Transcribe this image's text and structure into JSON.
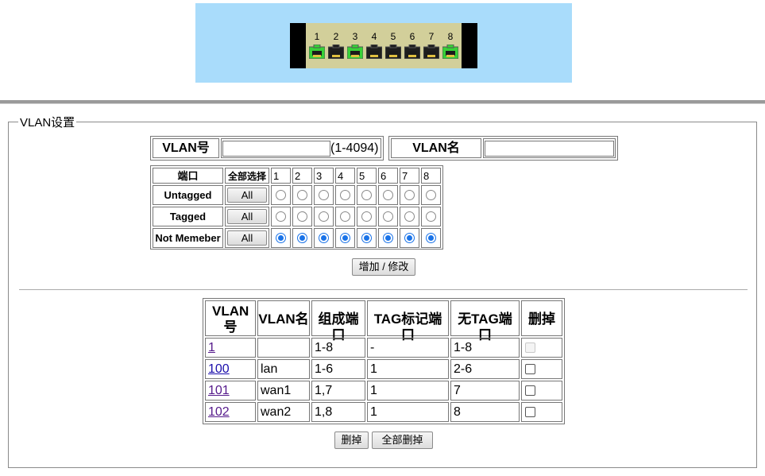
{
  "switch": {
    "ports": [
      {
        "num": "1",
        "status": "active",
        "color": "#37d137"
      },
      {
        "num": "2",
        "status": "inactive",
        "color": "#1e1e1e"
      },
      {
        "num": "3",
        "status": "active",
        "color": "#37d137"
      },
      {
        "num": "4",
        "status": "inactive",
        "color": "#1e1e1e"
      },
      {
        "num": "5",
        "status": "inactive",
        "color": "#1e1e1e"
      },
      {
        "num": "6",
        "status": "inactive",
        "color": "#1e1e1e"
      },
      {
        "num": "7",
        "status": "inactive",
        "color": "#1e1e1e"
      },
      {
        "num": "8",
        "status": "active",
        "color": "#37d137"
      }
    ]
  },
  "section_title": "VLAN设置",
  "vlan_id": {
    "label": "VLAN号",
    "value": "",
    "range_hint": "(1-4094)"
  },
  "vlan_name": {
    "label": "VLAN名",
    "value": ""
  },
  "port_table": {
    "header_port": "端口",
    "header_select_all": "全部选择",
    "port_numbers": [
      "1",
      "2",
      "3",
      "4",
      "5",
      "6",
      "7",
      "8"
    ],
    "rows": [
      {
        "label": "Untagged",
        "all_button": "All",
        "selected": [
          false,
          false,
          false,
          false,
          false,
          false,
          false,
          false
        ]
      },
      {
        "label": "Tagged",
        "all_button": "All",
        "selected": [
          false,
          false,
          false,
          false,
          false,
          false,
          false,
          false
        ]
      },
      {
        "label": "Not Memeber",
        "all_button": "All",
        "selected": [
          true,
          true,
          true,
          true,
          true,
          true,
          true,
          true
        ]
      }
    ]
  },
  "add_modify_button": "增加 / 修改",
  "vlan_list": {
    "headers": [
      "VLAN号",
      "VLAN名",
      "组成端口",
      "TAG标记端口",
      "无TAG端口",
      "删掉"
    ],
    "rows": [
      {
        "id": "1",
        "name": "",
        "members": "1-8",
        "tagged": "-",
        "untagged": "1-8",
        "delete_enabled": false
      },
      {
        "id": "100",
        "name": "lan",
        "members": "1-6",
        "tagged": "1",
        "untagged": "2-6",
        "delete_enabled": true
      },
      {
        "id": "101",
        "name": "wan1",
        "members": "1,7",
        "tagged": "1",
        "untagged": "7",
        "delete_enabled": true
      },
      {
        "id": "102",
        "name": "wan2",
        "members": "1,8",
        "tagged": "1",
        "untagged": "8",
        "delete_enabled": true
      }
    ]
  },
  "delete_button": "删掉",
  "delete_all_button": "全部删掉"
}
